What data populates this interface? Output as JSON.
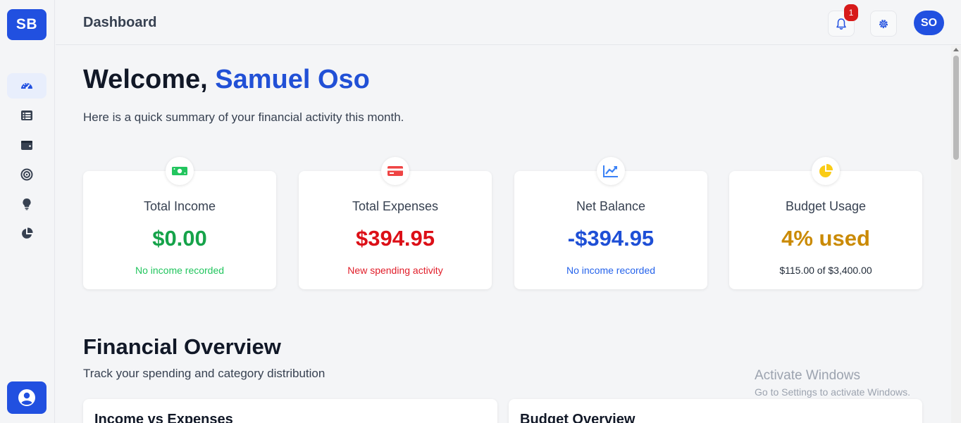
{
  "app": {
    "logo_text": "SB",
    "page_title": "Dashboard"
  },
  "header": {
    "notification_count": "1",
    "avatar_initials": "SO",
    "icons": [
      "bell-icon",
      "gear-icon"
    ]
  },
  "sidebar": {
    "items": [
      {
        "icon": "dashboard-gauge-icon",
        "active": true
      },
      {
        "icon": "list-icon",
        "active": false
      },
      {
        "icon": "wallet-icon",
        "active": false
      },
      {
        "icon": "target-icon",
        "active": false
      },
      {
        "icon": "lightbulb-icon",
        "active": false
      },
      {
        "icon": "pie-chart-icon",
        "active": false
      }
    ],
    "profile_icon": "user-circle-icon"
  },
  "welcome": {
    "greeting": "Welcome,",
    "name": "Samuel Oso",
    "subtitle": "Here is a quick summary of your financial activity this month."
  },
  "cards": [
    {
      "icon": "money-bill-icon",
      "title": "Total Income",
      "value": "$0.00",
      "note": "No income recorded",
      "color": "#16a34a",
      "note_color": "#22c55e"
    },
    {
      "icon": "credit-card-icon",
      "title": "Total Expenses",
      "value": "$394.95",
      "note": "New spending activity",
      "color": "#dc0f17",
      "note_color": "#e11d29"
    },
    {
      "icon": "chart-line-icon",
      "title": "Net Balance",
      "value": "-$394.95",
      "note": "No income recorded",
      "color": "#1e4fd6",
      "note_color": "#2563eb"
    },
    {
      "icon": "pie-chart-icon",
      "title": "Budget Usage",
      "value": "4% used",
      "note": "$115.00 of $3,400.00",
      "color": "#ca8a04",
      "note_color": "#1f2937"
    }
  ],
  "overview": {
    "title": "Financial Overview",
    "subtitle": "Track your spending and category distribution",
    "panels": [
      "Income vs Expenses",
      "Budget Overview"
    ]
  },
  "watermark": {
    "line1": "Activate Windows",
    "line2": "Go to Settings to activate Windows."
  },
  "colors": {
    "accent": "#2150e0"
  }
}
